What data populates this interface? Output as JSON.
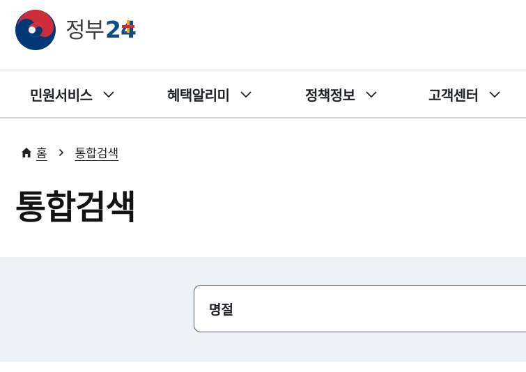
{
  "header": {
    "logo_word": "정부",
    "logo_number": "24",
    "brand_colors": {
      "blue": "#0b4d8a",
      "red": "#cd2e3a",
      "orange": "#f5a623"
    }
  },
  "gnb": {
    "items": [
      {
        "label": "민원서비스",
        "icon": "chevron-down-icon"
      },
      {
        "label": "혜택알리미",
        "icon": "chevron-down-icon"
      },
      {
        "label": "정책정보",
        "icon": "chevron-down-icon"
      },
      {
        "label": "고객센터",
        "icon": "chevron-down-icon"
      }
    ]
  },
  "breadcrumb": {
    "home_icon": "home-icon",
    "home": "홈",
    "separator_icon": "chevron-right-icon",
    "current": "통합검색"
  },
  "page": {
    "title": "통합검색"
  },
  "search": {
    "value": "명절",
    "background": "#eef2f7"
  }
}
